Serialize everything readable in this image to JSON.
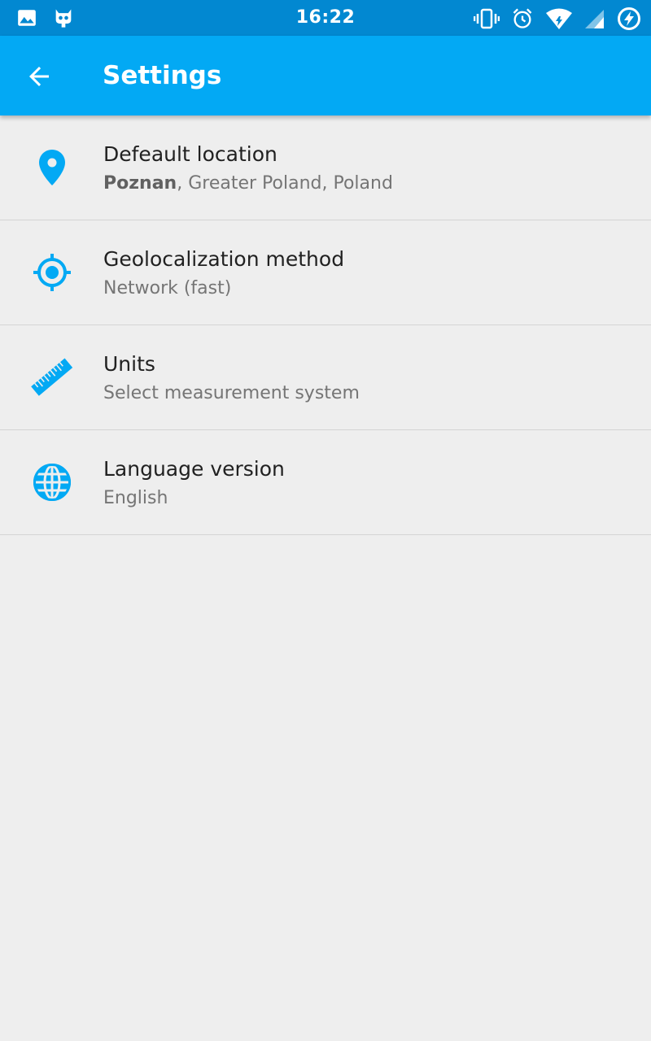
{
  "status_bar": {
    "time": "16:22",
    "left_icons": [
      "image-icon",
      "cyanogen-bot-icon"
    ],
    "right_icons": [
      "vibrate-icon",
      "alarm-icon",
      "wifi-icon",
      "signal-icon",
      "battery-charging-icon"
    ]
  },
  "app_bar": {
    "title": "Settings",
    "back_icon": "arrow-back-icon",
    "color": "#03a9f4",
    "status_color": "#0288d1"
  },
  "settings": {
    "accent": "#03a9f4",
    "items": [
      {
        "icon": "location-pin-icon",
        "title": "Defeault location",
        "subtitle_bold": "Poznan",
        "subtitle_rest": ", Greater Poland, Poland"
      },
      {
        "icon": "gps-target-icon",
        "title": "Geolocalization method",
        "subtitle": "Network (fast)"
      },
      {
        "icon": "ruler-icon",
        "title": "Units",
        "subtitle": "Select measurement system"
      },
      {
        "icon": "globe-icon",
        "title": "Language version",
        "subtitle": "English"
      }
    ]
  }
}
